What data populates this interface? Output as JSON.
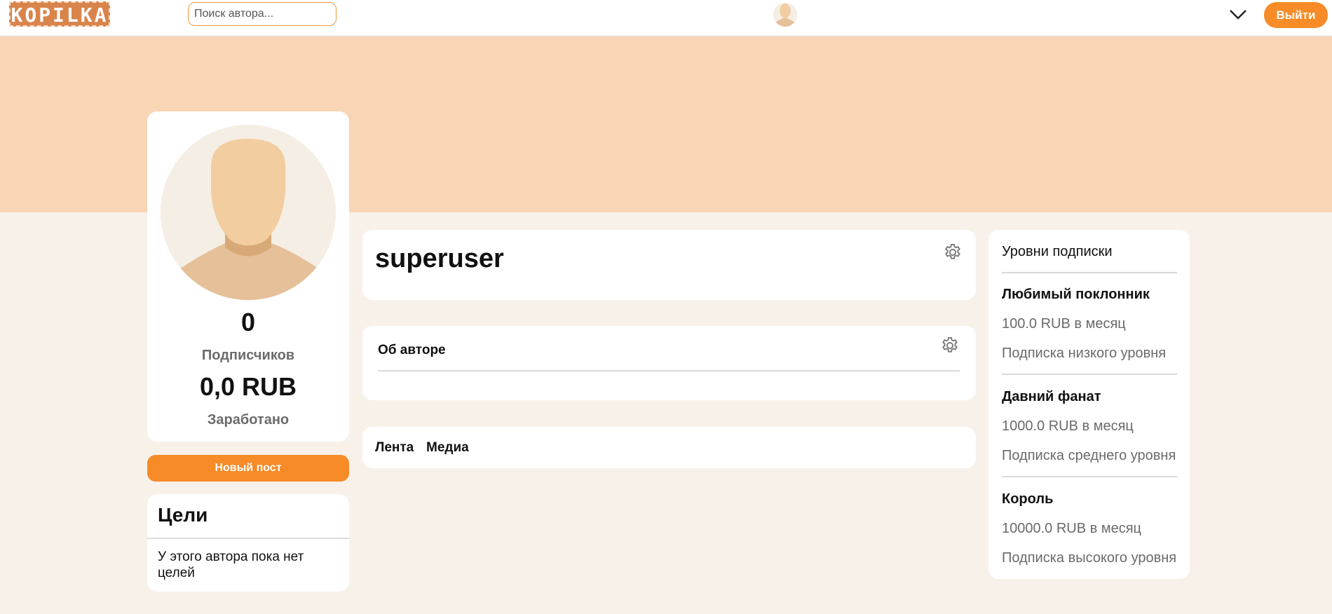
{
  "header": {
    "logo_text": "KOPILKA",
    "search_placeholder": "Поиск автора...",
    "logout_label": "Выйти"
  },
  "profile": {
    "subscribers_count": "0",
    "subscribers_label": "Подписчиков",
    "earned_amount": "0,0 RUB",
    "earned_label": "Заработано",
    "new_post_label": "Новый пост"
  },
  "goals": {
    "title": "Цели",
    "empty_text": "У этого автора пока нет целей"
  },
  "author": {
    "username": "superuser",
    "about_title": "Об авторе"
  },
  "tabs": [
    {
      "label": "Лента"
    },
    {
      "label": "Медиа"
    }
  ],
  "subscription_levels": {
    "title": "Уровни подписки",
    "levels": [
      {
        "name": "Любимый поклонник",
        "price": "100.0 RUB в месяц",
        "description": "Подписка низкого уровня"
      },
      {
        "name": "Давний фанат",
        "price": "1000.0 RUB в месяц",
        "description": "Подписка среднего уровня"
      },
      {
        "name": "Король",
        "price": "10000.0 RUB в месяц",
        "description": "Подписка высокого уровня"
      }
    ]
  },
  "colors": {
    "accent": "#f68b27",
    "banner": "#f8d5b5",
    "page_background": "#f7f1ea"
  },
  "icons": [
    "avatar-placeholder-icon",
    "chevron-down-icon",
    "gear-icon"
  ]
}
